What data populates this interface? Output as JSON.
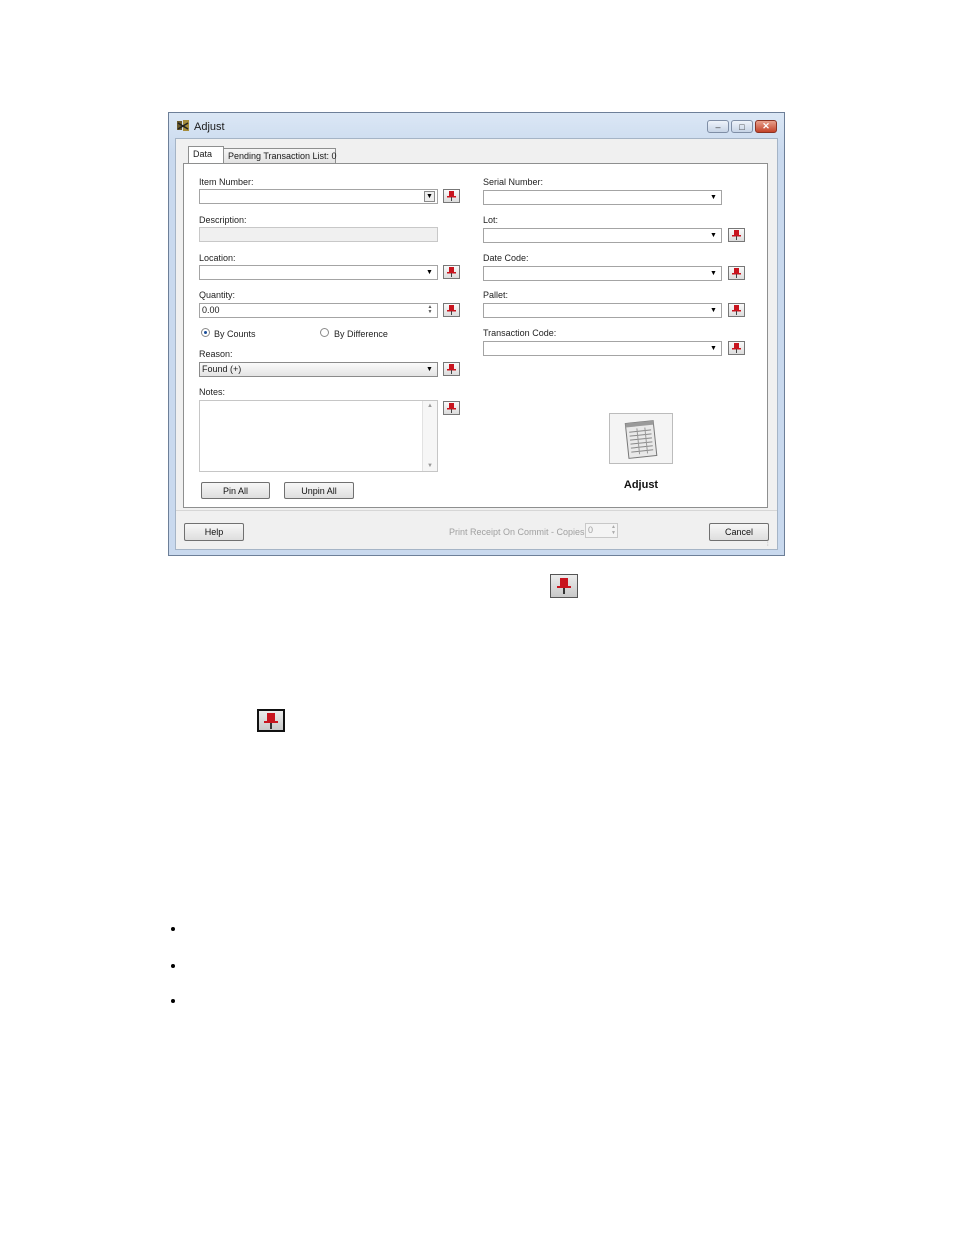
{
  "window": {
    "title": "Adjust",
    "caption_buttons": {
      "minimize": "–",
      "maximize": "□",
      "close": "✕"
    }
  },
  "tabs": [
    {
      "label": "Data"
    },
    {
      "label": "Pending Transaction List: 0"
    }
  ],
  "left": {
    "item_number_label": "Item Number:",
    "item_number_value": "",
    "description_label": "Description:",
    "location_label": "Location:",
    "location_value": "",
    "quantity_label": "Quantity:",
    "quantity_value": "0.00",
    "radio_by_counts": "By Counts",
    "radio_by_difference": "By Difference",
    "reason_label": "Reason:",
    "reason_value": "Found (+)",
    "notes_label": "Notes:",
    "notes_value": "",
    "pin_all": "Pin All",
    "unpin_all": "Unpin All"
  },
  "right": {
    "serial_number_label": "Serial Number:",
    "lot_label": "Lot:",
    "date_code_label": "Date Code:",
    "pallet_label": "Pallet:",
    "transaction_code_label": "Transaction Code:",
    "adjust_label": "Adjust"
  },
  "footer": {
    "help": "Help",
    "print_receipt_label": "Print Receipt On Commit - Copies:",
    "copies_value": "0",
    "cancel": "Cancel"
  },
  "icons": {
    "pin": "pin-icon",
    "adjust": "ledger-icon",
    "app": "app-icon"
  },
  "colors": {
    "pin_red": "#c8141e",
    "title_bar": "#c9d9ee",
    "close_red": "#c3432a"
  }
}
